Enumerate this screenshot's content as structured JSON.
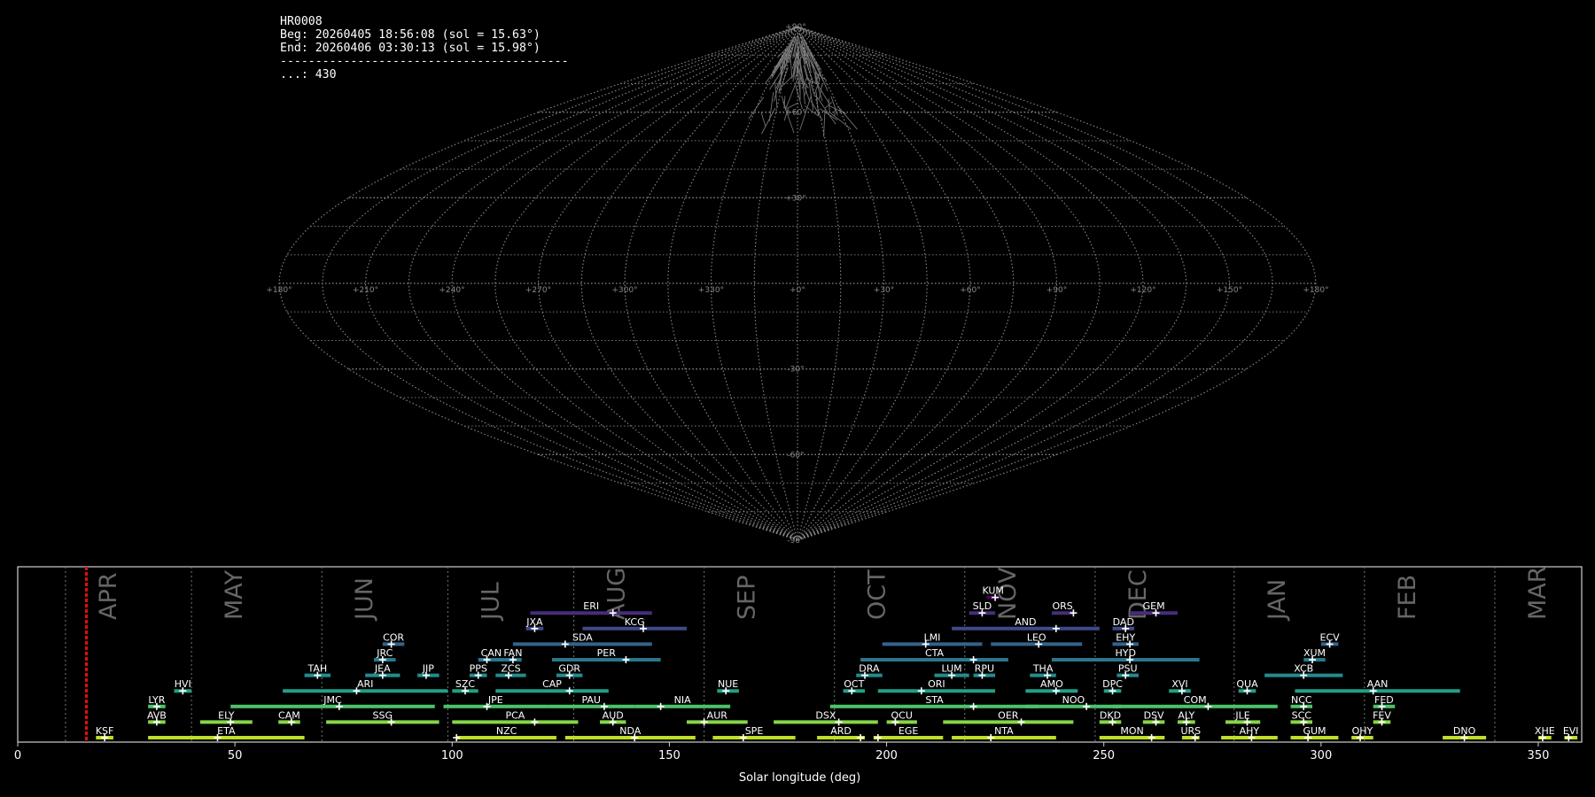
{
  "info": {
    "station": "HR0008",
    "begin": "Beg: 20260405 18:56:08 (sol = 15.63°)",
    "end": "End: 20260406 03:30:13 (sol = 15.98°)",
    "separator": "-----------------------------------------",
    "count": "...: 430"
  },
  "chart_data": [
    {
      "type": "sky-map",
      "projection": "sinusoidal",
      "lon_labels": [
        "+180°",
        "+150°",
        "+120°",
        "+90°",
        "+60°",
        "+30°",
        "+0°",
        "+330°",
        "+300°",
        "+270°",
        "+240°",
        "+210°",
        "+180°"
      ],
      "lat_labels": [
        "+90°",
        "+60°",
        "+30°",
        "-30°",
        "-60°",
        "-90°"
      ],
      "meteor_trails": 430
    },
    {
      "type": "bar",
      "xlabel": "Solar longitude (deg)",
      "xlim": [
        0,
        360
      ],
      "x_ticks": [
        "0",
        "50",
        "100",
        "150",
        "200",
        "250",
        "300",
        "350"
      ],
      "current_sol": 15.8,
      "months": [
        {
          "name": "APR",
          "start": 11
        },
        {
          "name": "MAY",
          "start": 40
        },
        {
          "name": "JUN",
          "start": 70
        },
        {
          "name": "JUL",
          "start": 99
        },
        {
          "name": "AUG",
          "start": 128
        },
        {
          "name": "SEP",
          "start": 158
        },
        {
          "name": "OCT",
          "start": 188
        },
        {
          "name": "NOV",
          "start": 218
        },
        {
          "name": "DEC",
          "start": 248
        },
        {
          "name": "JAN",
          "start": 280
        },
        {
          "name": "FEB",
          "start": 310
        },
        {
          "name": "MAR",
          "start": 340
        }
      ],
      "showers": [
        {
          "code": "KSF",
          "start": 18,
          "end": 22,
          "peak": 20,
          "row": 0,
          "color": "#bddf26"
        },
        {
          "code": "ETA",
          "start": 30,
          "end": 66,
          "peak": 46,
          "row": 0,
          "color": "#bddf26"
        },
        {
          "code": "NZC",
          "start": 101,
          "end": 124,
          "peak": 101,
          "row": 0,
          "color": "#bddf26"
        },
        {
          "code": "NDA",
          "start": 126,
          "end": 156,
          "peak": 142,
          "row": 0,
          "color": "#bddf26"
        },
        {
          "code": "SPE",
          "start": 160,
          "end": 179,
          "peak": 167,
          "row": 0,
          "color": "#bddf26"
        },
        {
          "code": "ARD",
          "start": 184,
          "end": 195,
          "peak": 194,
          "row": 0,
          "color": "#bddf26"
        },
        {
          "code": "EGE",
          "start": 197,
          "end": 213,
          "peak": 198,
          "row": 0,
          "color": "#bddf26"
        },
        {
          "code": "NTA",
          "start": 215,
          "end": 239,
          "peak": 224,
          "row": 0,
          "color": "#bddf26"
        },
        {
          "code": "MON",
          "start": 249,
          "end": 264,
          "peak": 261,
          "row": 0,
          "color": "#bddf26"
        },
        {
          "code": "URS",
          "start": 268,
          "end": 272,
          "peak": 271,
          "row": 0,
          "color": "#bddf26"
        },
        {
          "code": "AHY",
          "start": 277,
          "end": 290,
          "peak": 284,
          "row": 0,
          "color": "#bddf26"
        },
        {
          "code": "GUM",
          "start": 293,
          "end": 304,
          "peak": 297,
          "row": 0,
          "color": "#bddf26"
        },
        {
          "code": "OHY",
          "start": 307,
          "end": 312,
          "peak": 309,
          "row": 0,
          "color": "#bddf26"
        },
        {
          "code": "DNO",
          "start": 328,
          "end": 338,
          "peak": 333,
          "row": 0,
          "color": "#bddf26"
        },
        {
          "code": "XHE",
          "start": 350,
          "end": 353,
          "peak": 351,
          "row": 0,
          "color": "#bddf26"
        },
        {
          "code": "EVI",
          "start": 356,
          "end": 359,
          "peak": 357,
          "row": 0,
          "color": "#bddf26"
        },
        {
          "code": "AVB",
          "start": 30,
          "end": 34,
          "peak": 32,
          "row": 1,
          "color": "#86d549"
        },
        {
          "code": "ELY",
          "start": 42,
          "end": 54,
          "peak": 49,
          "row": 1,
          "color": "#86d549"
        },
        {
          "code": "CAM",
          "start": 60,
          "end": 65,
          "peak": 63,
          "row": 1,
          "color": "#86d549"
        },
        {
          "code": "SSG",
          "start": 71,
          "end": 97,
          "peak": 86,
          "row": 1,
          "color": "#86d549"
        },
        {
          "code": "PCA",
          "start": 100,
          "end": 129,
          "peak": 119,
          "row": 1,
          "color": "#86d549"
        },
        {
          "code": "AUD",
          "start": 134,
          "end": 140,
          "peak": 137,
          "row": 1,
          "color": "#86d549"
        },
        {
          "code": "AUR",
          "start": 154,
          "end": 168,
          "peak": 158,
          "row": 1,
          "color": "#86d549"
        },
        {
          "code": "DSX",
          "start": 174,
          "end": 198,
          "peak": 189,
          "row": 1,
          "color": "#86d549"
        },
        {
          "code": "OCU",
          "start": 200,
          "end": 207,
          "peak": 202,
          "row": 1,
          "color": "#86d549"
        },
        {
          "code": "OER",
          "start": 213,
          "end": 243,
          "peak": 231,
          "row": 1,
          "color": "#86d549"
        },
        {
          "code": "DKD",
          "start": 249,
          "end": 254,
          "peak": 252,
          "row": 1,
          "color": "#86d549"
        },
        {
          "code": "DSV",
          "start": 259,
          "end": 264,
          "peak": 262,
          "row": 1,
          "color": "#86d549"
        },
        {
          "code": "ALY",
          "start": 267,
          "end": 271,
          "peak": 269,
          "row": 1,
          "color": "#86d549"
        },
        {
          "code": "JLE",
          "start": 278,
          "end": 286,
          "peak": 283,
          "row": 1,
          "color": "#86d549"
        },
        {
          "code": "SCC",
          "start": 293,
          "end": 298,
          "peak": 296,
          "row": 1,
          "color": "#86d549"
        },
        {
          "code": "FEV",
          "start": 312,
          "end": 316,
          "peak": 314,
          "row": 1,
          "color": "#86d549"
        },
        {
          "code": "LYR",
          "start": 30,
          "end": 34,
          "peak": 32,
          "row": 2,
          "color": "#4cc26c"
        },
        {
          "code": "JMC",
          "start": 49,
          "end": 96,
          "peak": 74,
          "row": 2,
          "color": "#4cc26c"
        },
        {
          "code": "JPE",
          "start": 98,
          "end": 122,
          "peak": 108,
          "row": 2,
          "color": "#4cc26c"
        },
        {
          "code": "PAU",
          "start": 122,
          "end": 142,
          "peak": 135,
          "row": 2,
          "color": "#4cc26c"
        },
        {
          "code": "NIA",
          "start": 142,
          "end": 164,
          "peak": 148,
          "row": 2,
          "color": "#4cc26c"
        },
        {
          "code": "STA",
          "start": 187,
          "end": 235,
          "peak": 220,
          "row": 2,
          "color": "#4cc26c"
        },
        {
          "code": "NOO",
          "start": 232,
          "end": 254,
          "peak": 246,
          "row": 2,
          "color": "#4cc26c"
        },
        {
          "code": "COM",
          "start": 252,
          "end": 290,
          "peak": 274,
          "row": 2,
          "color": "#4cc26c"
        },
        {
          "code": "NCC",
          "start": 293,
          "end": 298,
          "peak": 296,
          "row": 2,
          "color": "#4cc26c"
        },
        {
          "code": "FED",
          "start": 312,
          "end": 317,
          "peak": 314,
          "row": 2,
          "color": "#4cc26c"
        },
        {
          "code": "HVI",
          "start": 36,
          "end": 40,
          "peak": 38,
          "row": 3,
          "color": "#1fa187"
        },
        {
          "code": "ARI",
          "start": 61,
          "end": 99,
          "peak": 78,
          "row": 3,
          "color": "#1fa187"
        },
        {
          "code": "SZC",
          "start": 100,
          "end": 106,
          "peak": 103,
          "row": 3,
          "color": "#1fa187"
        },
        {
          "code": "CAP",
          "start": 110,
          "end": 136,
          "peak": 127,
          "row": 3,
          "color": "#1fa187"
        },
        {
          "code": "NUE",
          "start": 161,
          "end": 166,
          "peak": 163,
          "row": 3,
          "color": "#1fa187"
        },
        {
          "code": "OCT",
          "start": 190,
          "end": 195,
          "peak": 192,
          "row": 3,
          "color": "#1fa187"
        },
        {
          "code": "ORI",
          "start": 198,
          "end": 225,
          "peak": 208,
          "row": 3,
          "color": "#1fa187"
        },
        {
          "code": "AMO",
          "start": 232,
          "end": 244,
          "peak": 239,
          "row": 3,
          "color": "#1fa187"
        },
        {
          "code": "DPC",
          "start": 250,
          "end": 254,
          "peak": 252,
          "row": 3,
          "color": "#1fa187"
        },
        {
          "code": "XVI",
          "start": 265,
          "end": 270,
          "peak": 268,
          "row": 3,
          "color": "#1fa187"
        },
        {
          "code": "QUA",
          "start": 281,
          "end": 285,
          "peak": 283,
          "row": 3,
          "color": "#1fa187"
        },
        {
          "code": "AAN",
          "start": 294,
          "end": 332,
          "peak": 312,
          "row": 3,
          "color": "#1fa187"
        },
        {
          "code": "TAH",
          "start": 66,
          "end": 72,
          "peak": 69,
          "row": 4,
          "color": "#228c8d"
        },
        {
          "code": "JEA",
          "start": 80,
          "end": 88,
          "peak": 84,
          "row": 4,
          "color": "#228c8d"
        },
        {
          "code": "JIP",
          "start": 92,
          "end": 97,
          "peak": 94,
          "row": 4,
          "color": "#228c8d"
        },
        {
          "code": "PPS",
          "start": 104,
          "end": 108,
          "peak": 106,
          "row": 4,
          "color": "#228c8d"
        },
        {
          "code": "ZCS",
          "start": 110,
          "end": 117,
          "peak": 113,
          "row": 4,
          "color": "#228c8d"
        },
        {
          "code": "GDR",
          "start": 124,
          "end": 130,
          "peak": 127,
          "row": 4,
          "color": "#228c8d"
        },
        {
          "code": "DRA",
          "start": 193,
          "end": 199,
          "peak": 195,
          "row": 4,
          "color": "#228c8d"
        },
        {
          "code": "LUM",
          "start": 211,
          "end": 219,
          "peak": 215,
          "row": 4,
          "color": "#228c8d"
        },
        {
          "code": "RPU",
          "start": 220,
          "end": 225,
          "peak": 222,
          "row": 4,
          "color": "#228c8d"
        },
        {
          "code": "THA",
          "start": 233,
          "end": 239,
          "peak": 237,
          "row": 4,
          "color": "#228c8d"
        },
        {
          "code": "PSU",
          "start": 253,
          "end": 258,
          "peak": 255,
          "row": 4,
          "color": "#228c8d"
        },
        {
          "code": "XCB",
          "start": 287,
          "end": 305,
          "peak": 296,
          "row": 4,
          "color": "#228c8d"
        },
        {
          "code": "JRC",
          "start": 82,
          "end": 87,
          "peak": 84,
          "row": 5,
          "color": "#2a788e"
        },
        {
          "code": "CAN",
          "start": 106,
          "end": 112,
          "peak": 108,
          "row": 5,
          "color": "#2a788e"
        },
        {
          "code": "FAN",
          "start": 112,
          "end": 116,
          "peak": 114,
          "row": 5,
          "color": "#2a788e"
        },
        {
          "code": "PER",
          "start": 123,
          "end": 148,
          "peak": 140,
          "row": 5,
          "color": "#2a788e"
        },
        {
          "code": "CTA",
          "start": 194,
          "end": 228,
          "peak": 220,
          "row": 5,
          "color": "#2a788e"
        },
        {
          "code": "HYD",
          "start": 238,
          "end": 272,
          "peak": 256,
          "row": 5,
          "color": "#2a788e"
        },
        {
          "code": "XUM",
          "start": 296,
          "end": 301,
          "peak": 298,
          "row": 5,
          "color": "#2a788e"
        },
        {
          "code": "COR",
          "start": 84,
          "end": 89,
          "peak": 86,
          "row": 6,
          "color": "#33638d"
        },
        {
          "code": "SDA",
          "start": 114,
          "end": 146,
          "peak": 126,
          "row": 6,
          "color": "#33638d"
        },
        {
          "code": "LMI",
          "start": 199,
          "end": 222,
          "peak": 209,
          "row": 6,
          "color": "#33638d"
        },
        {
          "code": "LEO",
          "start": 224,
          "end": 245,
          "peak": 235,
          "row": 6,
          "color": "#33638d"
        },
        {
          "code": "EHY",
          "start": 252,
          "end": 258,
          "peak": 256,
          "row": 6,
          "color": "#33638d"
        },
        {
          "code": "ECV",
          "start": 300,
          "end": 304,
          "peak": 302,
          "row": 6,
          "color": "#33638d"
        },
        {
          "code": "JXA",
          "start": 117,
          "end": 121,
          "peak": 119,
          "row": 7,
          "color": "#3e4a89"
        },
        {
          "code": "KCG",
          "start": 130,
          "end": 154,
          "peak": 144,
          "row": 7,
          "color": "#3e4a89"
        },
        {
          "code": "AND",
          "start": 215,
          "end": 249,
          "peak": 239,
          "row": 7,
          "color": "#3e4a89"
        },
        {
          "code": "DAD",
          "start": 252,
          "end": 257,
          "peak": 255,
          "row": 7,
          "color": "#3e4a89"
        },
        {
          "code": "ERI",
          "start": 118,
          "end": 146,
          "peak": 137,
          "row": 8,
          "color": "#472d7b"
        },
        {
          "code": "SLD",
          "start": 219,
          "end": 225,
          "peak": 222,
          "row": 8,
          "color": "#472d7b"
        },
        {
          "code": "ORS",
          "start": 238,
          "end": 243,
          "peak": 243,
          "row": 8,
          "color": "#472d7b"
        },
        {
          "code": "GEM",
          "start": 256,
          "end": 267,
          "peak": 262,
          "row": 8,
          "color": "#472d7b"
        },
        {
          "code": "KUM",
          "start": 223,
          "end": 226,
          "peak": 225,
          "row": 9,
          "color": "#440154"
        }
      ]
    }
  ]
}
